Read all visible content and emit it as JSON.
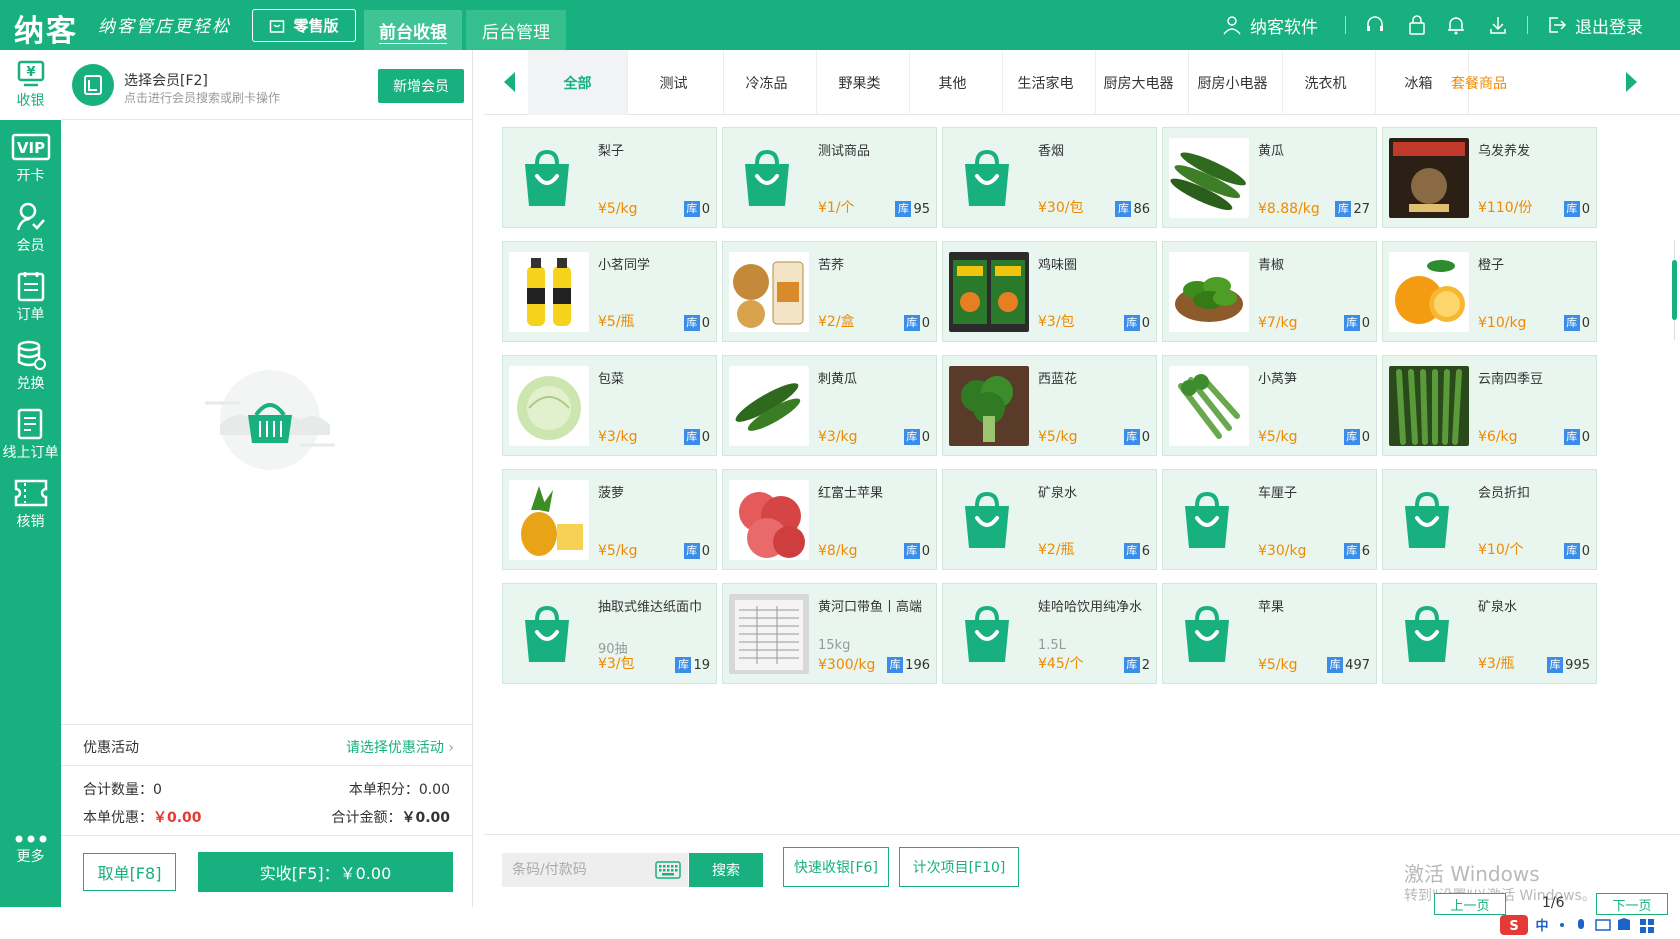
{
  "topbar": {
    "logo": "纳客",
    "slogan": "纳客管店更轻松",
    "edition": "零售版",
    "nav": [
      {
        "label": "前台收银",
        "active": true
      },
      {
        "label": "后台管理",
        "active": false
      }
    ],
    "user": "纳客软件",
    "logout": "退出登录",
    "brand_color": "#17b07e"
  },
  "sidebar": {
    "items": [
      {
        "label": "收银",
        "icon": "cashier-icon",
        "active": true
      },
      {
        "label": "开卡",
        "icon": "vip-card-icon"
      },
      {
        "label": "会员",
        "icon": "member-icon"
      },
      {
        "label": "订单",
        "icon": "order-icon"
      },
      {
        "label": "兑换",
        "icon": "exchange-icon"
      },
      {
        "label": "线上订单",
        "icon": "online-order-icon"
      },
      {
        "label": "核销",
        "icon": "verify-icon"
      },
      {
        "label": "更多",
        "icon": "more-icon"
      }
    ]
  },
  "member": {
    "title": "选择会员[F2]",
    "subtitle": "点击进行会员搜索或刷卡操作",
    "new_button": "新增会员"
  },
  "promo": {
    "label": "优惠活动",
    "link": "请选择优惠活动"
  },
  "totals": {
    "count_label": "合计数量：",
    "count_value": "0",
    "points_label": "本单积分：",
    "points_value": "0.00",
    "discount_label": "本单优惠：",
    "discount_value": "￥0.00",
    "amount_label": "合计金额：",
    "amount_value": "￥0.00"
  },
  "actions": {
    "cancel": "取单[F8]",
    "pay": "实收[F5]：￥0.00"
  },
  "categories": [
    {
      "label": "全部",
      "active": true
    },
    {
      "label": "测试"
    },
    {
      "label": "冷冻品"
    },
    {
      "label": "野果类"
    },
    {
      "label": "其他"
    },
    {
      "label": "生活家电"
    },
    {
      "label": "厨房大电器"
    },
    {
      "label": "厨房小电器"
    },
    {
      "label": "洗衣机"
    },
    {
      "label": "冰箱"
    },
    {
      "label": "套餐商品",
      "highlight": true
    }
  ],
  "products": [
    {
      "name": "梨子",
      "price": "¥5/kg",
      "stock": "0",
      "img": "bag"
    },
    {
      "name": "测试商品",
      "price": "¥1/个",
      "stock": "95",
      "img": "bag"
    },
    {
      "name": "香烟",
      "price": "¥30/包",
      "stock": "86",
      "img": "bag"
    },
    {
      "name": "黄瓜",
      "price": "¥8.88/kg",
      "stock": "27",
      "img": "cucumber"
    },
    {
      "name": "乌发养发",
      "price": "¥110/份",
      "stock": "0",
      "img": "book"
    },
    {
      "name": "小茗同学",
      "price": "¥5/瓶",
      "stock": "0",
      "img": "drink"
    },
    {
      "name": "苦荞",
      "price": "¥2/盒",
      "stock": "0",
      "img": "buckwheat"
    },
    {
      "name": "鸡味圈",
      "price": "¥3/包",
      "stock": "0",
      "img": "snack"
    },
    {
      "name": "青椒",
      "price": "¥7/kg",
      "stock": "0",
      "img": "pepper"
    },
    {
      "name": "橙子",
      "price": "¥10/kg",
      "stock": "0",
      "img": "orange"
    },
    {
      "name": "包菜",
      "price": "¥3/kg",
      "stock": "0",
      "img": "cabbage"
    },
    {
      "name": "刺黄瓜",
      "price": "¥3/kg",
      "stock": "0",
      "img": "cucumber2"
    },
    {
      "name": "西蓝花",
      "price": "¥5/kg",
      "stock": "0",
      "img": "broccoli"
    },
    {
      "name": "小莴笋",
      "price": "¥5/kg",
      "stock": "0",
      "img": "lettuce"
    },
    {
      "name": "云南四季豆",
      "price": "¥6/kg",
      "stock": "0",
      "img": "beans"
    },
    {
      "name": "菠萝",
      "price": "¥5/kg",
      "stock": "0",
      "img": "pineapple"
    },
    {
      "name": "红富士苹果",
      "price": "¥8/kg",
      "stock": "0",
      "img": "apple"
    },
    {
      "name": "矿泉水",
      "price": "¥2/瓶",
      "stock": "6",
      "img": "bag"
    },
    {
      "name": "车厘子",
      "price": "¥30/kg",
      "stock": "6",
      "img": "bag"
    },
    {
      "name": "会员折扣",
      "price": "¥10/个",
      "stock": "0",
      "img": "bag"
    },
    {
      "name": "抽取式维达纸面巾",
      "spec": "90抽",
      "price": "¥3/包",
      "stock": "19",
      "img": "bag"
    },
    {
      "name": "黄河口带鱼丨高端",
      "spec": "15kg",
      "price": "¥300/kg",
      "stock": "196",
      "img": "doc"
    },
    {
      "name": "娃哈哈饮用纯净水",
      "spec": "1.5L",
      "price": "¥45/个",
      "stock": "2",
      "img": "bag"
    },
    {
      "name": "苹果",
      "price": "¥5/kg",
      "stock": "497",
      "img": "bag"
    },
    {
      "name": "矿泉水",
      "price": "¥3/瓶",
      "stock": "995",
      "img": "bag"
    }
  ],
  "stock_label": "库",
  "bottom": {
    "barcode_placeholder": "条码/付款码",
    "search": "搜索",
    "quick": "快速收银[F6]",
    "count_item": "计次项目[F10]",
    "watermark_title": "激活 Windows",
    "watermark_sub": "转到\"设置\"以激活 Windows。",
    "prev": "上一页",
    "page": "1/6",
    "next": "下一页",
    "ime": "中"
  }
}
